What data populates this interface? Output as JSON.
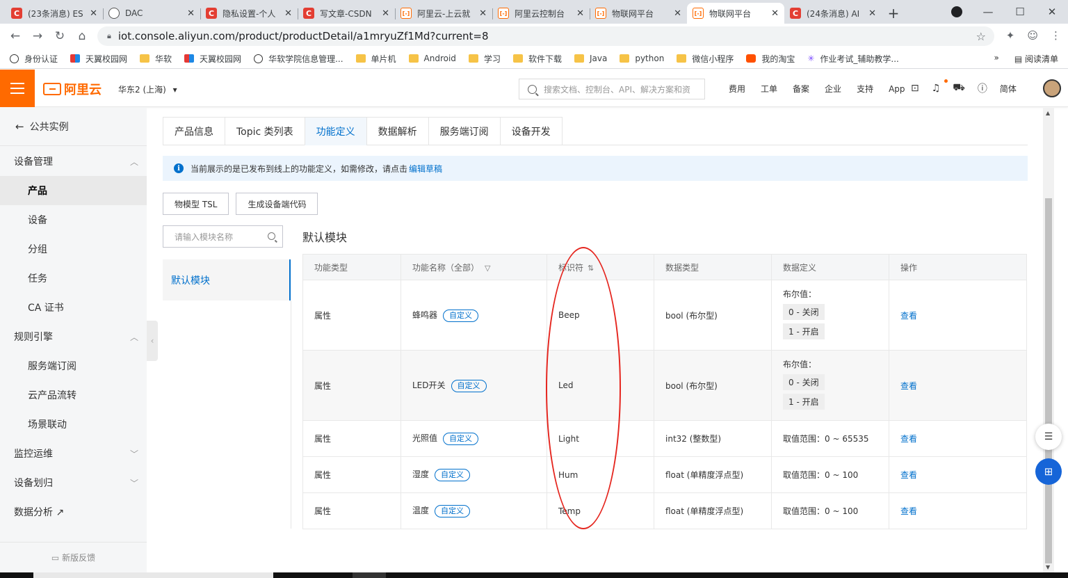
{
  "browser": {
    "tabs": [
      {
        "icon": "csdn",
        "title": "(23条消息) ES"
      },
      {
        "icon": "globe",
        "title": "DAC"
      },
      {
        "icon": "csdn",
        "title": "隐私设置-个人"
      },
      {
        "icon": "csdn",
        "title": "写文章-CSDN"
      },
      {
        "icon": "aliyun",
        "title": "阿里云-上云就"
      },
      {
        "icon": "aliyun",
        "title": "阿里云控制台"
      },
      {
        "icon": "aliyun",
        "title": "物联网平台"
      },
      {
        "icon": "aliyun",
        "title": "物联网平台"
      },
      {
        "icon": "csdn",
        "title": "(24条消息) AI"
      }
    ],
    "active_tab_index": 7,
    "url": "iot.console.aliyun.com/product/productDetail/a1mryuZf1Md?current=8",
    "bookmarks": [
      {
        "icon": "globe",
        "label": "身份认证"
      },
      {
        "icon": "tianyi",
        "label": "天翼校园网"
      },
      {
        "icon": "folder",
        "label": "华软"
      },
      {
        "icon": "tianyi",
        "label": "天翼校园网"
      },
      {
        "icon": "globe",
        "label": "华软学院信息管理..."
      },
      {
        "icon": "folder",
        "label": "单片机"
      },
      {
        "icon": "folder",
        "label": "Android"
      },
      {
        "icon": "folder",
        "label": "学习"
      },
      {
        "icon": "folder",
        "label": "软件下载"
      },
      {
        "icon": "folder",
        "label": "Java"
      },
      {
        "icon": "folder",
        "label": "python"
      },
      {
        "icon": "folder",
        "label": "微信小程序"
      },
      {
        "icon": "taobao",
        "label": "我的淘宝"
      },
      {
        "icon": "star",
        "label": "作业考试_辅助教学..."
      }
    ],
    "more_bookmarks": "»",
    "reading_list": "阅读清单"
  },
  "header": {
    "logo": "阿里云",
    "region": "华东2 (上海)",
    "search_placeholder": "搜索文档、控制台、API、解决方案和资",
    "nav": [
      "费用",
      "工单",
      "备案",
      "企业",
      "支持",
      "App"
    ],
    "lang": "简体"
  },
  "sidebar": {
    "back_label": "公共实例",
    "items": [
      {
        "label": "设备管理",
        "type": "group",
        "chevron": "up"
      },
      {
        "label": "产品",
        "type": "sub",
        "active": true
      },
      {
        "label": "设备",
        "type": "sub"
      },
      {
        "label": "分组",
        "type": "sub"
      },
      {
        "label": "任务",
        "type": "sub"
      },
      {
        "label": "CA 证书",
        "type": "sub"
      },
      {
        "label": "规则引擎",
        "type": "group",
        "chevron": "up"
      },
      {
        "label": "服务端订阅",
        "type": "sub"
      },
      {
        "label": "云产品流转",
        "type": "sub"
      },
      {
        "label": "场景联动",
        "type": "sub"
      },
      {
        "label": "监控运维",
        "type": "group",
        "chevron": "down"
      },
      {
        "label": "设备划归",
        "type": "group",
        "chevron": "down"
      },
      {
        "label": "数据分析 ↗",
        "type": "group"
      }
    ],
    "feedback": "新版反馈"
  },
  "page_tabs": [
    "产品信息",
    "Topic 类列表",
    "功能定义",
    "数据解析",
    "服务端订阅",
    "设备开发"
  ],
  "active_page_tab": 2,
  "notice": {
    "text": "当前展示的是已发布到线上的功能定义，如需修改，请点击",
    "link": "编辑草稿"
  },
  "buttons": {
    "tsl": "物模型 TSL",
    "gen_code": "生成设备端代码"
  },
  "module_search_placeholder": "请输入模块名称",
  "module_list": [
    "默认模块"
  ],
  "module_title": "默认模块",
  "table": {
    "headers": [
      "功能类型",
      "功能名称（全部）",
      "标识符",
      "数据类型",
      "数据定义",
      "操作"
    ],
    "rows": [
      {
        "type": "属性",
        "name": "蜂鸣器",
        "tag": "自定义",
        "id": "Beep",
        "dtype": "bool (布尔型)",
        "def_title": "布尔值：",
        "def_values": [
          "0 - 关闭",
          "1 - 开启"
        ],
        "action": "查看"
      },
      {
        "type": "属性",
        "name": "LED开关",
        "tag": "自定义",
        "id": "Led",
        "dtype": "bool (布尔型)",
        "def_title": "布尔值：",
        "def_values": [
          "0 - 关闭",
          "1 - 开启"
        ],
        "action": "查看"
      },
      {
        "type": "属性",
        "name": "光照值",
        "tag": "自定义",
        "id": "Light",
        "dtype": "int32 (整数型)",
        "def_text": "取值范围：0 ~ 65535",
        "action": "查看"
      },
      {
        "type": "属性",
        "name": "湿度",
        "tag": "自定义",
        "id": "Hum",
        "dtype": "float (单精度浮点型)",
        "def_text": "取值范围：0 ~ 100",
        "action": "查看"
      },
      {
        "type": "属性",
        "name": "温度",
        "tag": "自定义",
        "id": "Temp",
        "dtype": "float (单精度浮点型)",
        "def_text": "取值范围：0 ~ 100",
        "action": "查看"
      }
    ]
  },
  "colors": {
    "accent": "#0070cc",
    "brand_orange": "#ff6a00",
    "annotation_red": "#e5261f"
  }
}
